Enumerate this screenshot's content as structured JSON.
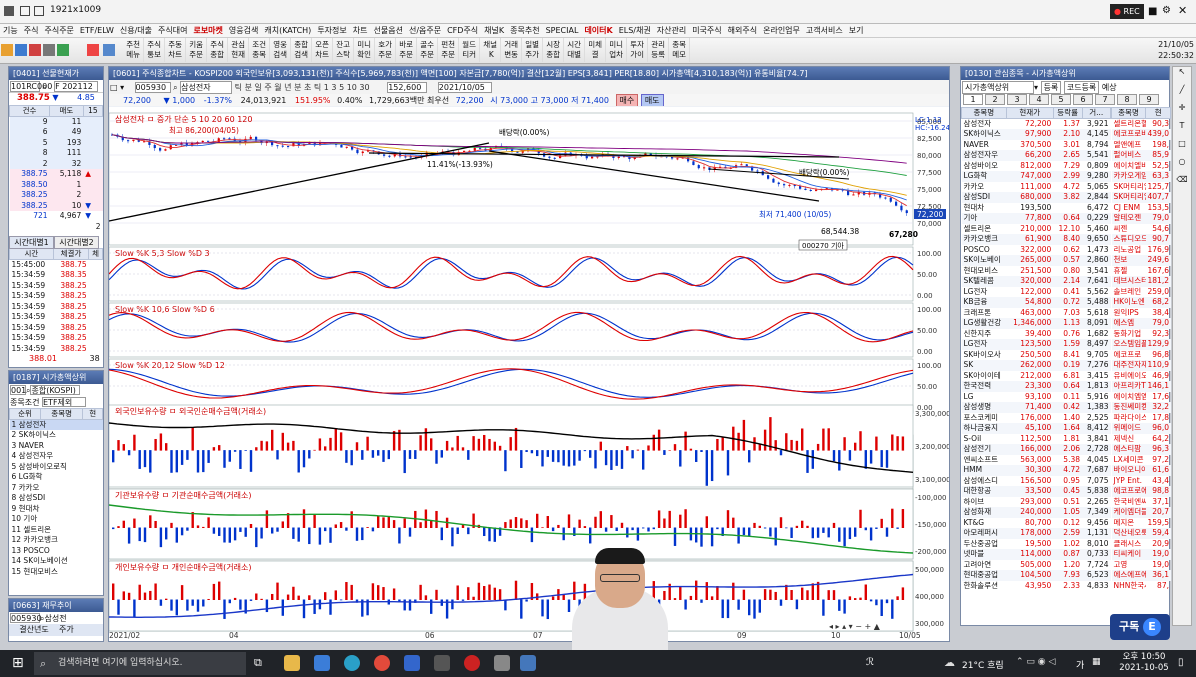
{
  "window": {
    "title": "1921x1009",
    "rec": "REC"
  },
  "menu": [
    "기능",
    "주식",
    "주식주문",
    "ETF/ELW",
    "신용/대출",
    "주식대여",
    "로보마켓",
    "영웅검색",
    "캐치(KATCH)",
    "투자정보",
    "차트",
    "선물옵션",
    "선/옵주문",
    "CFD주식",
    "채널K",
    "종목추천",
    "SPECIAL",
    "데이터K",
    "ELS/채권",
    "자산관리",
    "미국주식",
    "해외주식",
    "온라인업무",
    "고객서비스",
    "보기"
  ],
  "clock": {
    "date": "21/10/05",
    "time": "22:50:32"
  },
  "toolbar": [
    "주천\n메뉴",
    "주식\n통보",
    "주동\n차트",
    "키움\n주문",
    "주식\n종합",
    "관심\n현재",
    "조건\n종목",
    "영웅\n검색",
    "종합\n검색",
    "오픈\n차트",
    "잔고\n스탁",
    "미니\n확인",
    "호가\n주문",
    "바로\n주문",
    "골수\n주문",
    "펀천\n주문",
    "월드\n티커",
    "채널\n K",
    "거래\n변동",
    "일별\n주가",
    "시장\n종합",
    "시간\n대별",
    "미체\n결",
    "미니\n업차",
    "투자\n가이",
    "관리\n등록",
    "종목\n메모"
  ],
  "left_panel": {
    "title": "[0401] 선물현재가",
    "code": "101RC000",
    "name": "F 202112",
    "price": "388.75",
    "change": "▼",
    "chg_val": "4.85",
    "ob_headers": [
      "건수",
      "매도",
      "15"
    ],
    "orderbook": [
      [
        "9",
        "11",
        ""
      ],
      [
        "6",
        "49",
        ""
      ],
      [
        "5",
        "193",
        ""
      ],
      [
        "8",
        "111",
        ""
      ],
      [
        "2",
        "32",
        ""
      ],
      [
        "388.75",
        "5,118",
        "▲"
      ],
      [
        "388.50",
        "1",
        ""
      ],
      [
        "388.25",
        "2",
        ""
      ],
      [
        "388.25",
        "10",
        "▼"
      ],
      [
        "721",
        "4,967",
        "▼"
      ],
      [
        "",
        "",
        "2"
      ]
    ],
    "tabs": [
      "시간대별1",
      "시간대별2"
    ],
    "time_headers": [
      "시간",
      "체결가",
      "체"
    ],
    "time_rows": [
      [
        "15:45:00",
        "388.75"
      ],
      [
        "15:34:59",
        "388.35"
      ],
      [
        "15:34:59",
        "388.25"
      ],
      [
        "15:34:59",
        "388.25"
      ],
      [
        "15:34:59",
        "388.25"
      ],
      [
        "15:34:59",
        "388.25"
      ],
      [
        "15:34:59",
        "388.25"
      ],
      [
        "15:34:59",
        "388.25"
      ],
      [
        "15:34:59",
        "388.25"
      ]
    ],
    "last": "388.01",
    "last2": "38"
  },
  "rank_panel": {
    "title": "[0187] 시가총액상위",
    "market": "001",
    "market_name": "종합(KOSPI)",
    "cond_label": "종목조건",
    "cond": "ETF제외",
    "headers": [
      "순위",
      "종목명",
      "현"
    ],
    "items": [
      "1 삼성전자",
      "2 SK하이닉스",
      "3 NAVER",
      "4 삼성전자우",
      "5 삼성바이오로직",
      "6 LG화학",
      "7 카카오",
      "8 삼성SDI",
      "9 현대차",
      "10 기아",
      "11 셀트리온",
      "12 카카오뱅크",
      "13 POSCO",
      "14 SK이노베이션",
      "15 현대모비스"
    ]
  },
  "fin_panel": {
    "title": "[0663] 재무추이",
    "code": "005930",
    "name": "삼성전",
    "col1": "결산년도",
    "col2": "주가"
  },
  "chart_window": {
    "title": "[0601] 주식종합차트 - KOSPI200 외국인보유[3,093,131(천)] 주식수[5,969,783(천)] 액면[100] 자본금[7,780(억)] 결산[12월] EPS[3,841] PER[18.80] 시가총액[4,310,183(억)] 유통비율[74.7]",
    "code": "005930",
    "name": "삼성전자",
    "period": "152,600",
    "date": "2021/10/05",
    "price": "72,200",
    "chg": "▼ 1,000",
    "pct": "-1.37%",
    "vol": "24,013,921",
    "ratio": "151.95%",
    "turnover": "0.40%",
    "amount": "1,729,663백만",
    "low_label": "최우선",
    "best": "72,200",
    "bids": [
      "72,100",
      "72,000",
      "72,200"
    ],
    "ohl": "시 73,000 고 73,000 저 71,400",
    "buy": "매수",
    "sell": "매도"
  },
  "price_chart": {
    "legend": "삼성전자 ㅁ 증가 단순 5  10  20  60  120",
    "high_label": "최고 86,200(04/05)",
    "low_label": "최저 71,400 (10/05)",
    "div1": "배당락(0.00%)",
    "div2": "배당락(0.00%)",
    "pct_label": "11.41%(-13.93%)",
    "lc": "LC:1.12",
    "hc": "HC:-16.24",
    "level1": "68,544.38",
    "level2": "67,280",
    "cur": "72,200",
    "yticks": [
      "85,000",
      "82,500",
      "80,000",
      "77,500",
      "75,000",
      "72,500",
      "70,000"
    ],
    "tooltip": "000270 기아"
  },
  "chart_data": [
    {
      "type": "line",
      "title": "Slow %K 5,3  Slow %D 3",
      "yticks": [
        "100.00",
        "50.00",
        "0.00"
      ],
      "ylim": [
        0,
        100
      ]
    },
    {
      "type": "line",
      "title": "Slow %K 10,6  Slow %D 6",
      "yticks": [
        "100.00",
        "50.00",
        "0.00"
      ],
      "ylim": [
        0,
        100
      ]
    },
    {
      "type": "line",
      "title": "Slow %K 20,12  Slow %D 12",
      "yticks": [
        "100.00",
        "50.00",
        "0.00"
      ],
      "ylim": [
        0,
        100
      ]
    },
    {
      "type": "bar",
      "title": "외국인보유수량 ㅁ 외국인순매수금액(거래소)",
      "yticks": [
        "3,300,000",
        "3,200,000",
        "3,100,000"
      ]
    },
    {
      "type": "bar",
      "title": "기관보유수량 ㅁ 기관순매수금액(거래소)",
      "yticks": [
        "-100,000",
        "-150,000",
        "-200,000"
      ]
    },
    {
      "type": "bar",
      "title": "개인보유수량 ㅁ 개인순매수금액(거래소)",
      "yticks": [
        "500,000",
        "400,000",
        "300,000"
      ]
    }
  ],
  "xaxis": [
    "2021/02",
    "04",
    "06",
    "07",
    "08",
    "09",
    "10",
    "10/05"
  ],
  "watch": {
    "title": "[0130] 관심종목 - 시가총액상위",
    "group": "시가총액상위",
    "reg": "등록",
    "code_reg": "코드등록",
    "pred": "예상",
    "tabs": [
      "1",
      "2",
      "3",
      "4",
      "5",
      "6",
      "7",
      "8",
      "9"
    ],
    "headers": [
      "종목명",
      "현재가",
      "등락률",
      "거..."
    ],
    "headers2": [
      "종목명",
      "현"
    ],
    "rows": [
      [
        "삼성전자",
        "72,200",
        "1.37",
        "3,921",
        "r"
      ],
      [
        "SK하이닉스",
        "97,900",
        "2.10",
        "4,145",
        "r"
      ],
      [
        "NAVER",
        "370,500",
        "3.01",
        "8,794",
        "r"
      ],
      [
        "삼성전자우",
        "66,200",
        "2.65",
        "5,541",
        "r"
      ],
      [
        "삼성바이오",
        "812,000",
        "7.29",
        "0,809",
        "r"
      ],
      [
        "LG화학",
        "747,000",
        "2.99",
        "9,280",
        "r"
      ],
      [
        "카카오",
        "111,000",
        "4.72",
        "5,065",
        "r"
      ],
      [
        "삼성SDI",
        "680,000",
        "3.82",
        "2,844",
        "r"
      ],
      [
        "현대차",
        "193,500",
        "",
        "6,472",
        ""
      ],
      [
        "기아",
        "77,800",
        "0.64",
        "0,229",
        "r"
      ],
      [
        "셀트리온",
        "210,000",
        "12.10",
        "5,460",
        "r"
      ],
      [
        "카카오뱅크",
        "61,900",
        "8.40",
        "9,650",
        "r"
      ],
      [
        "POSCO",
        "322,000",
        "0.62",
        "1,473",
        "r"
      ],
      [
        "SK이노베이",
        "265,000",
        "0.57",
        "2,860",
        "r"
      ],
      [
        "현대모비스",
        "251,500",
        "0.80",
        "3,541",
        "r"
      ],
      [
        "SK텔레콤",
        "320,000",
        "2.14",
        "7,641",
        "r"
      ],
      [
        "LG전자",
        "122,000",
        "0.41",
        "5,562",
        "r"
      ],
      [
        "KB금융",
        "54,800",
        "0.72",
        "5,488",
        "r"
      ],
      [
        "크래프톤",
        "463,000",
        "7.03",
        "5,618",
        "r"
      ],
      [
        "LG생활건강",
        "1,346,000",
        "1.13",
        "8,091",
        "r"
      ],
      [
        "신한지주",
        "39,400",
        "0.76",
        "1,682",
        "r"
      ],
      [
        "LG전자",
        "123,500",
        "1.59",
        "8,497",
        "r"
      ],
      [
        "SK바이오사",
        "250,500",
        "8.41",
        "9,705",
        "r"
      ],
      [
        "SK",
        "262,000",
        "0.19",
        "7,276",
        "r"
      ],
      [
        "SK아이이테",
        "212,000",
        "6.81",
        "3,415",
        "r"
      ],
      [
        "한국전력",
        "23,300",
        "0.64",
        "1,813",
        "r"
      ],
      [
        "LG",
        "93,100",
        "0.11",
        "5,916",
        "r"
      ],
      [
        "삼성생명",
        "71,400",
        "0.42",
        "1,383",
        "r"
      ],
      [
        "포스코케미",
        "176,000",
        "1.40",
        "2,525",
        "r"
      ],
      [
        "하나금융지",
        "45,100",
        "1.64",
        "8,412",
        "r"
      ],
      [
        "S-Oil",
        "112,500",
        "1.81",
        "3,841",
        "r"
      ],
      [
        "삼성전기",
        "166,000",
        "2.06",
        "2,728",
        "r"
      ],
      [
        "엔씨소프트",
        "563,000",
        "5.38",
        "4,045",
        "r"
      ],
      [
        "HMM",
        "30,300",
        "4.72",
        "7,687",
        "r"
      ],
      [
        "삼성에스디",
        "156,500",
        "0.95",
        "7,075",
        "r"
      ],
      [
        "대한항공",
        "33,500",
        "0.45",
        "5,838",
        "r"
      ],
      [
        "하이브",
        "293,000",
        "0.51",
        "2,265",
        "r"
      ],
      [
        "삼성화재",
        "240,000",
        "1.05",
        "7,349",
        "r"
      ],
      [
        "KT&G",
        "80,700",
        "0.12",
        "9,456",
        "r"
      ],
      [
        "아모레퍼시",
        "178,000",
        "2.59",
        "1,131",
        "r"
      ],
      [
        "두산중공업",
        "19,500",
        "1.02",
        "8,010",
        "r"
      ],
      [
        "넷마블",
        "114,000",
        "0.87",
        "0,733",
        "r"
      ],
      [
        "고려아연",
        "505,000",
        "1.20",
        "7,724",
        "r"
      ],
      [
        "현대중공업",
        "104,500",
        "7.93",
        "6,523",
        "r"
      ],
      [
        "한화솔루션",
        "43,950",
        "2.33",
        "4,833",
        "r"
      ]
    ],
    "rows2": [
      [
        "셀트리온헬",
        "90,3"
      ],
      [
        "에코프로비",
        "439,0"
      ],
      [
        "엘앤에프",
        "198,"
      ],
      [
        "펄어비스",
        "85,9"
      ],
      [
        "에이치엘비",
        "52,5"
      ],
      [
        "카카오게임",
        "63,3"
      ],
      [
        "SK머티리얼",
        "125,7"
      ],
      [
        "SK머티리얼",
        "407,7"
      ],
      [
        "CJ ENM",
        "153,5"
      ],
      [
        "알테오젠",
        "79,0"
      ],
      [
        "씨젠",
        "54,6"
      ],
      [
        "스튜디오드",
        "90,7"
      ],
      [
        "리노공업",
        "176,9"
      ],
      [
        "천보",
        "249,6"
      ],
      [
        "휴젤",
        "167,6"
      ],
      [
        "데브시스터",
        "181,2"
      ],
      [
        "솔브레인",
        "259,0"
      ],
      [
        "HK이노엔",
        "68,2"
      ],
      [
        "원익IPS",
        "38,4"
      ],
      [
        "에스엠",
        "79,0"
      ],
      [
        "동화기업",
        "92,3"
      ],
      [
        "오스템임플",
        "129,9"
      ],
      [
        "에코프로",
        "96,8"
      ],
      [
        "대주전자재",
        "110,9"
      ],
      [
        "유비에이오",
        "46,9"
      ],
      [
        "아프리카TV",
        "146,1"
      ],
      [
        "에이치엠엠",
        "17,6"
      ],
      [
        "동진쎄미켐",
        "32,2"
      ],
      [
        "파라다이스",
        "17,8"
      ],
      [
        "위메이드",
        "96,0"
      ],
      [
        "제넥신",
        "64,2"
      ],
      [
        "에스티팜",
        "96,3"
      ],
      [
        "LX세미콘",
        "97,2"
      ],
      [
        "바이오니아",
        "61,6"
      ],
      [
        "JYP Ent.",
        "43,4"
      ],
      [
        "에코프로에",
        "98,8"
      ],
      [
        "한국비엔씨",
        "37,1"
      ],
      [
        "케이엠더블",
        "20,7"
      ],
      [
        "메지온",
        "159,5"
      ],
      [
        "덕산네오룩",
        "59,4"
      ],
      [
        "클래시스",
        "20,9"
      ],
      [
        "티씨케이",
        "19,0"
      ],
      [
        "고영",
        "19,0"
      ],
      [
        "에스에프에",
        "36,1"
      ],
      [
        "NHN한국사",
        "87,"
      ]
    ]
  },
  "taskbar": {
    "search": "검색하려면 여기에 입력하십시오.",
    "weather": "21°C 흐림",
    "ime": "가",
    "time": "오후 10:50",
    "date": "2021-10-05"
  },
  "logo": "구독"
}
